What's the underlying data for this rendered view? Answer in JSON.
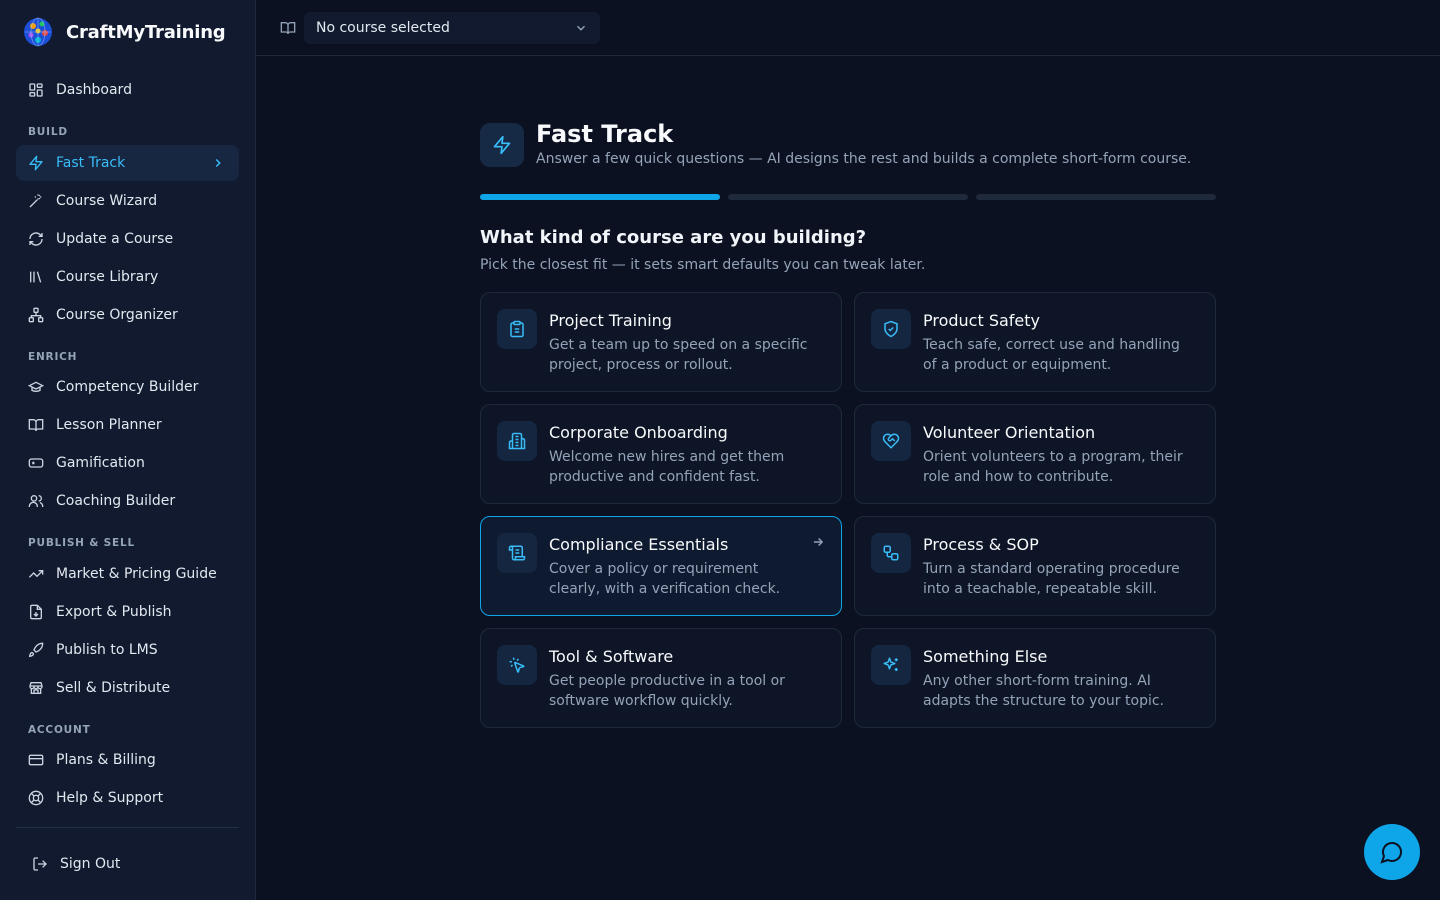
{
  "brand": {
    "name": "CraftMyTraining"
  },
  "sidebar": {
    "dashboard": "Dashboard",
    "sections": {
      "build": "BUILD",
      "enrich": "ENRICH",
      "publish": "PUBLISH & SELL",
      "account": "ACCOUNT"
    },
    "items": {
      "fast_track": "Fast Track",
      "course_wizard": "Course Wizard",
      "update_course": "Update a Course",
      "course_library": "Course Library",
      "course_organizer": "Course Organizer",
      "competency_builder": "Competency Builder",
      "lesson_planner": "Lesson Planner",
      "gamification": "Gamification",
      "coaching_builder": "Coaching Builder",
      "market_pricing": "Market & Pricing Guide",
      "export_publish": "Export & Publish",
      "publish_lms": "Publish to LMS",
      "sell_distribute": "Sell & Distribute",
      "plans_billing": "Plans & Billing",
      "help_support": "Help & Support"
    },
    "sign_out": "Sign Out",
    "active": "fast_track"
  },
  "topbar": {
    "course_select": "No course selected"
  },
  "main": {
    "title": "Fast Track",
    "subtitle": "Answer a few quick questions — AI designs the rest and builds a complete short-form course.",
    "progress": {
      "current_step": 1,
      "total_steps": 3
    },
    "question": "What kind of course are you building?",
    "hint": "Pick the closest fit — it sets smart defaults you can tweak later.",
    "cards": {
      "project_training": {
        "title": "Project Training",
        "desc": "Get a team up to speed on a specific project, process or rollout.",
        "icon": "clipboard-icon"
      },
      "product_safety": {
        "title": "Product Safety",
        "desc": "Teach safe, correct use and handling of a product or equipment.",
        "icon": "shield-check-icon"
      },
      "corporate_onboarding": {
        "title": "Corporate Onboarding",
        "desc": "Welcome new hires and get them productive and confident fast.",
        "icon": "building-icon"
      },
      "volunteer_orientation": {
        "title": "Volunteer Orientation",
        "desc": "Orient volunteers to a program, their role and how to contribute.",
        "icon": "heart-handshake-icon"
      },
      "compliance_essentials": {
        "title": "Compliance Essentials",
        "desc": "Cover a policy or requirement clearly, with a verification check.",
        "icon": "scroll-icon"
      },
      "process_sop": {
        "title": "Process & SOP",
        "desc": "Turn a standard operating procedure into a teachable, repeatable skill.",
        "icon": "workflow-icon"
      },
      "tool_software": {
        "title": "Tool & Software",
        "desc": "Get people productive in a tool or software workflow quickly.",
        "icon": "pointer-click-icon"
      },
      "something_else": {
        "title": "Something Else",
        "desc": "Any other short-form training. AI adapts the structure to your topic.",
        "icon": "sparkles-icon"
      }
    },
    "selected_card": "compliance_essentials"
  },
  "colors": {
    "accent": "#0ea5e9",
    "accent_text": "#38bdf8",
    "background": "#0b1120",
    "sidebar": "#111a2e"
  }
}
